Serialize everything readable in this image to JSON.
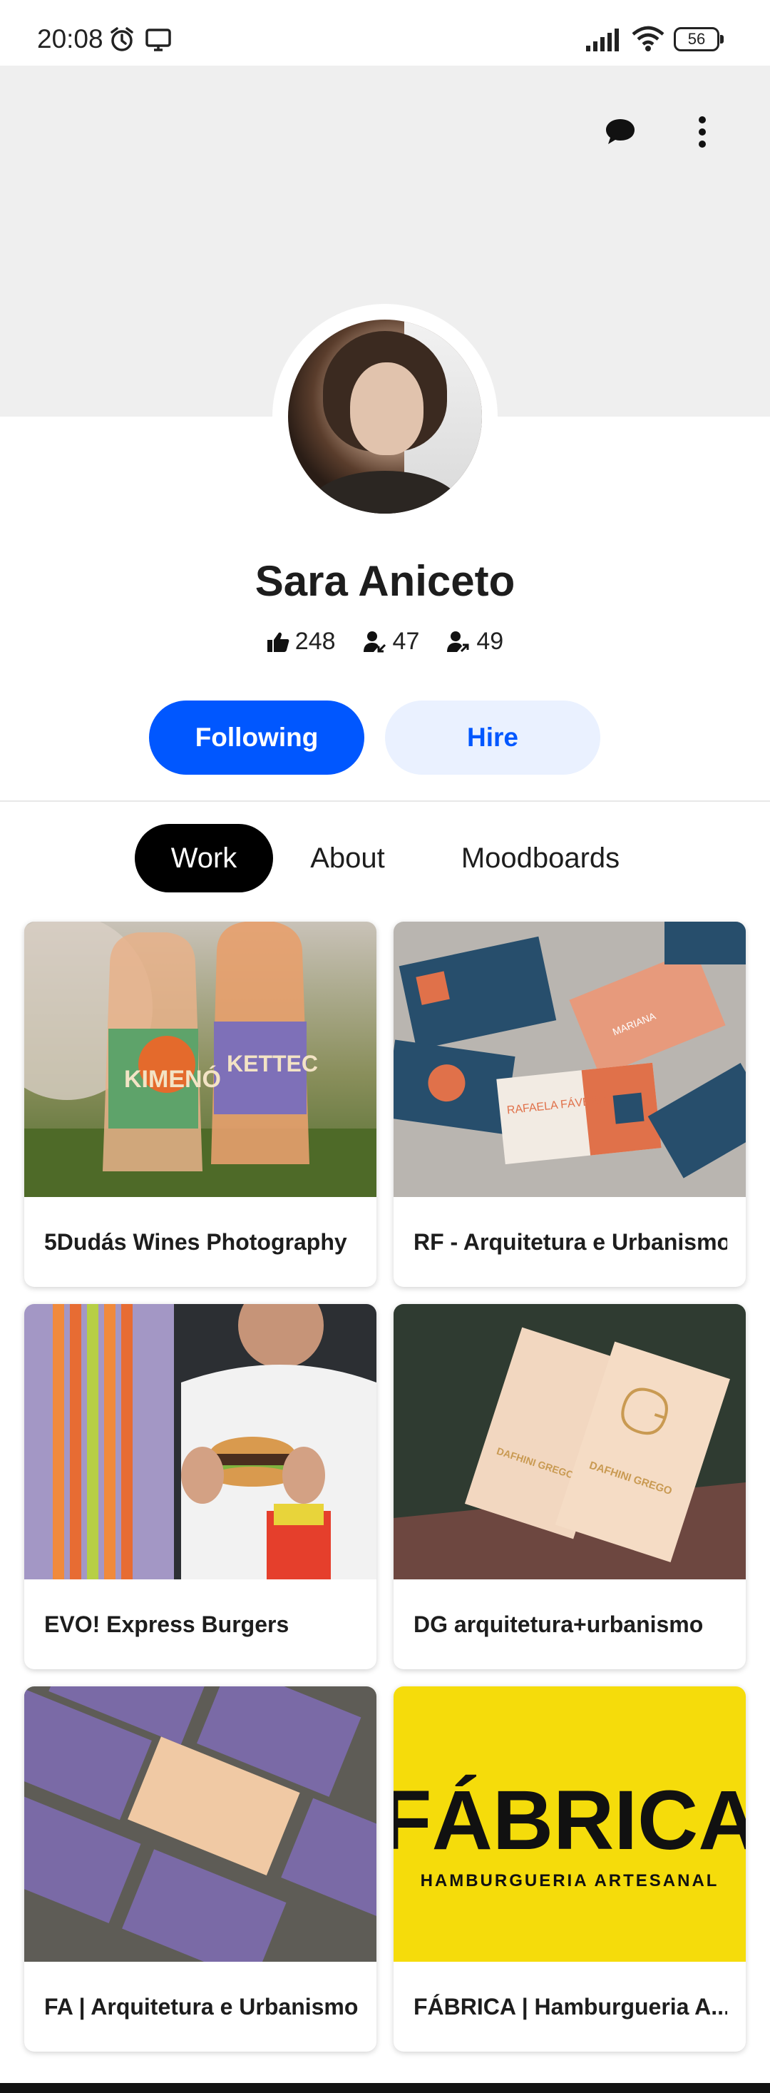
{
  "status_bar": {
    "time": "20:08",
    "battery": "56"
  },
  "header": {
    "chat_icon": "chat-bubble-icon",
    "more_icon": "more-vertical-icon"
  },
  "profile": {
    "name": "Sara Aniceto",
    "stats": {
      "appreciations": "248",
      "followers": "47",
      "following": "49"
    },
    "following_button": "Following",
    "hire_button": "Hire"
  },
  "tabs": [
    {
      "label": "Work",
      "active": true
    },
    {
      "label": "About",
      "active": false
    },
    {
      "label": "Moodboards",
      "active": false
    }
  ],
  "projects": [
    {
      "title": "5Dudás Wines Photography"
    },
    {
      "title": "RF - Arquitetura e Urbanismo"
    },
    {
      "title": "EVO! Express Burgers"
    },
    {
      "title": "DG arquitetura+urbanismo"
    },
    {
      "title": "FA | Arquitetura e Urbanismo"
    },
    {
      "title": "FÁBRICA | Hamburgueria A..."
    }
  ],
  "artwork_text": {
    "fabrica_logo": "FÁBRICA",
    "fabrica_sub": "HAMBURGUERIA ARTESANAL",
    "bottle_left": "KIMENÓ",
    "bottle_right": "KETTEC",
    "card_rf": "RAFAELA FÁVERO",
    "card_dg": "DAFHINI GREGO"
  },
  "colors": {
    "accent": "#0057ff",
    "accent_soft": "#eaf1ff",
    "banner": "#efefef",
    "fabrica_yellow": "#f5dc0b"
  }
}
